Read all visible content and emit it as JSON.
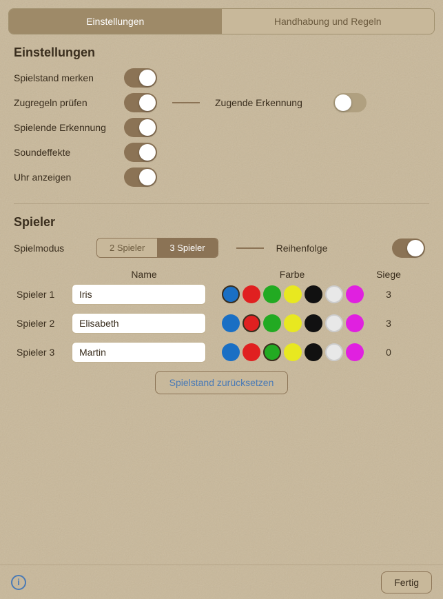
{
  "tabs": [
    {
      "id": "einstellungen",
      "label": "Einstellungen",
      "active": true
    },
    {
      "id": "handhabung",
      "label": "Handhabung und Regeln",
      "active": false
    }
  ],
  "einstellungen": {
    "title": "Einstellungen",
    "settings": [
      {
        "id": "spielstand-merken",
        "label": "Spielstand merken",
        "on": true
      },
      {
        "id": "zugregeln-pruefen",
        "label": "Zugregeln prüfen",
        "on": true,
        "has_extra": true,
        "extra_label": "Zugende Erkennung",
        "extra_on": false
      },
      {
        "id": "spielende-erkennung",
        "label": "Spielende Erkennung",
        "on": true
      },
      {
        "id": "soundeffekte",
        "label": "Soundeffekte",
        "on": true
      },
      {
        "id": "uhr-anzeigen",
        "label": "Uhr anzeigen",
        "on": true
      }
    ]
  },
  "spieler": {
    "title": "Spieler",
    "spielmodus_label": "Spielmodus",
    "segments": [
      {
        "label": "2 Spieler",
        "active": false
      },
      {
        "label": "3 Spieler",
        "active": true
      }
    ],
    "reihenfolge_label": "Reihenfolge",
    "reihenfolge_on": true,
    "table_headers": {
      "name": "Name",
      "farbe": "Farbe",
      "siege": "Siege"
    },
    "players": [
      {
        "label": "Spieler 1",
        "name": "Iris",
        "selected_color": 0,
        "siege": "3",
        "colors": [
          "#1a6fc4",
          "#e02020",
          "#22aa22",
          "#e8e820",
          "#111111",
          "#e8e8e8",
          "#e020e0"
        ]
      },
      {
        "label": "Spieler 2",
        "name": "Elisabeth",
        "selected_color": 1,
        "siege": "3",
        "colors": [
          "#1a6fc4",
          "#e02020",
          "#22aa22",
          "#e8e820",
          "#111111",
          "#e8e8e8",
          "#e020e0"
        ]
      },
      {
        "label": "Spieler 3",
        "name": "Martin",
        "selected_color": 2,
        "siege": "0",
        "colors": [
          "#1a6fc4",
          "#e02020",
          "#22aa22",
          "#e8e820",
          "#111111",
          "#e8e8e8",
          "#e020e0"
        ]
      }
    ],
    "reset_button": "Spielstand zurücksetzen"
  },
  "bottom": {
    "info_label": "i",
    "fertig_label": "Fertig"
  }
}
